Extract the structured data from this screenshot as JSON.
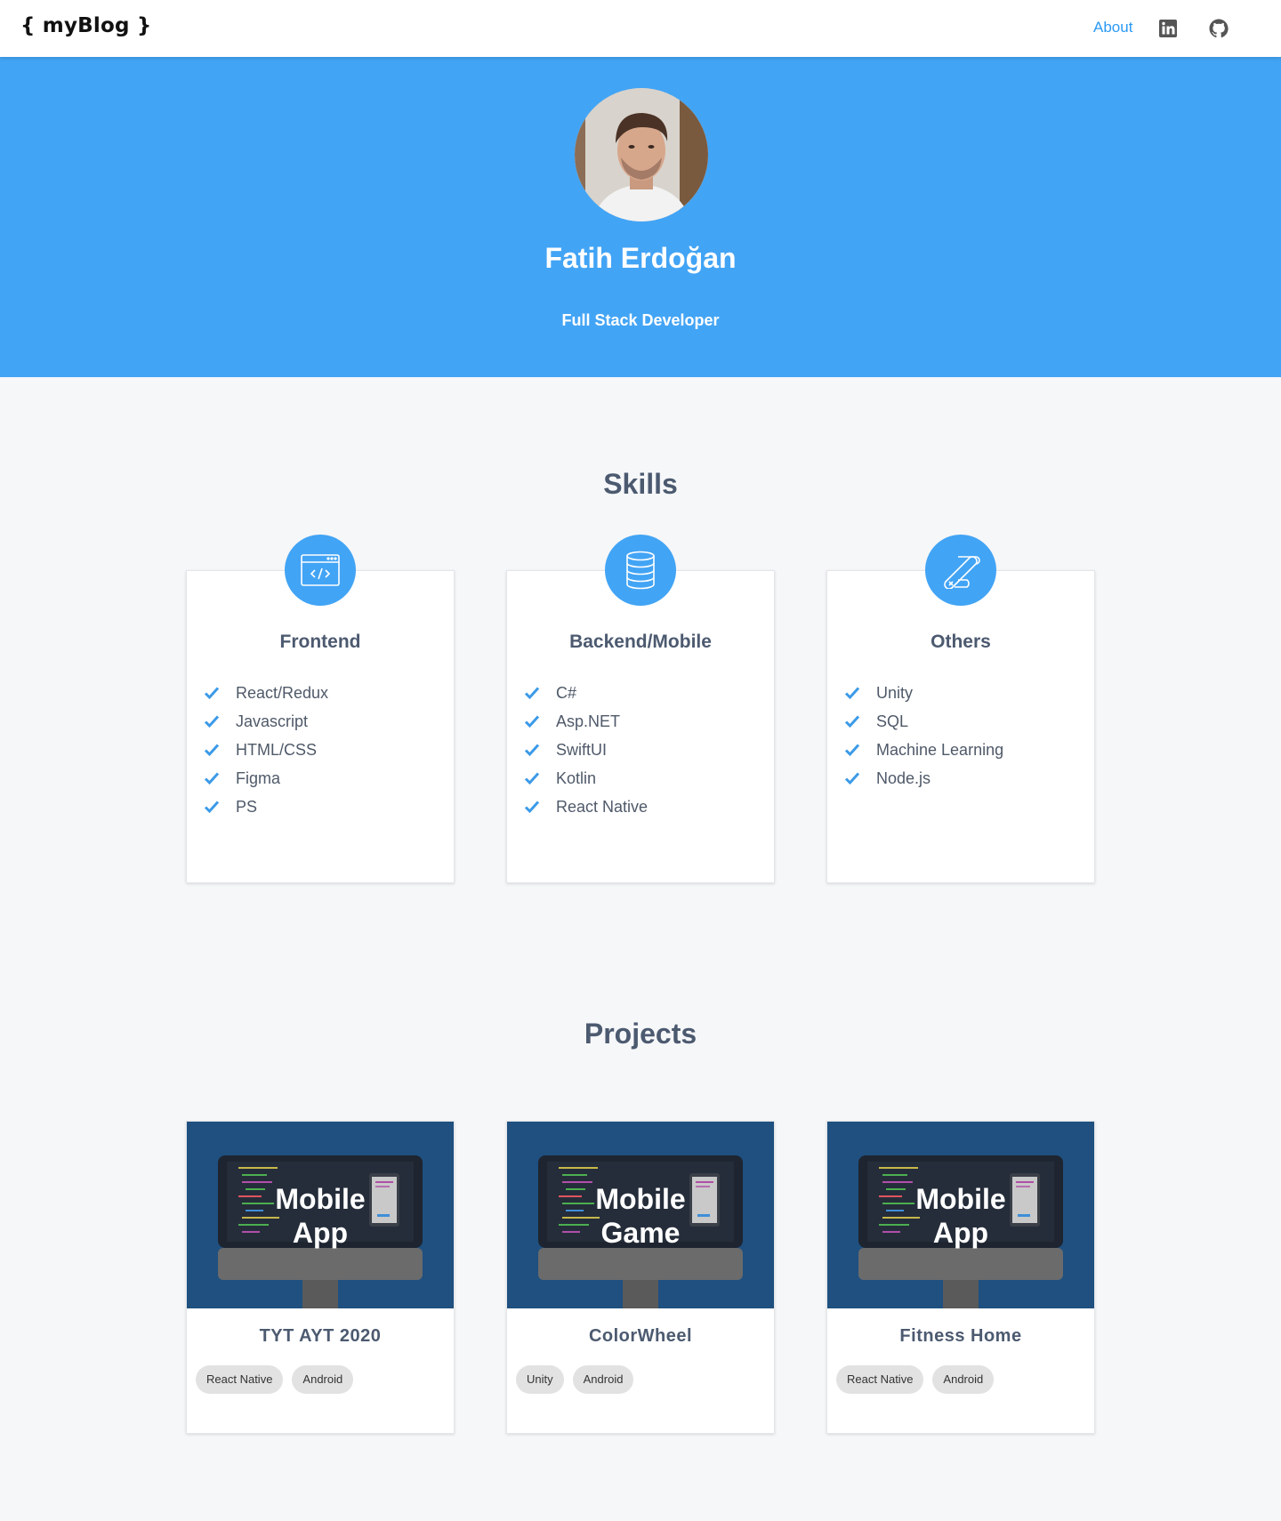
{
  "header": {
    "logo": "{ myBlog }",
    "nav_about": "About",
    "linkedin_icon": "linkedin-icon",
    "github_icon": "github-icon"
  },
  "hero": {
    "name": "Fatih Erdoğan",
    "role": "Full Stack Developer",
    "background": "#42a4f5"
  },
  "skills": {
    "title": "Skills",
    "cards": [
      {
        "icon": "code-window-icon",
        "heading": "Frontend",
        "items": [
          "React/Redux",
          "Javascript",
          "HTML/CSS",
          "Figma",
          "PS"
        ]
      },
      {
        "icon": "database-icon",
        "heading": "Backend/Mobile",
        "items": [
          "C#",
          "Asp.NET",
          "SwiftUI",
          "Kotlin",
          "React Native"
        ]
      },
      {
        "icon": "swiss-knife-icon",
        "heading": "Others",
        "items": [
          "Unity",
          "SQL",
          "Machine Learning",
          "Node.js"
        ]
      }
    ]
  },
  "projects": {
    "title": "Projects",
    "cards": [
      {
        "thumb_line1": "Mobile",
        "thumb_line2": "App",
        "name": "TYT AYT 2020",
        "tags": [
          "React Native",
          "Android"
        ]
      },
      {
        "thumb_line1": "Mobile",
        "thumb_line2": "Game",
        "name": "ColorWheel",
        "tags": [
          "Unity",
          "Android"
        ]
      },
      {
        "thumb_line1": "Mobile",
        "thumb_line2": "App",
        "name": "Fitness Home",
        "tags": [
          "React Native",
          "Android"
        ]
      }
    ]
  },
  "colors": {
    "accent": "#42a4f5",
    "link": "#2b9af3",
    "heading": "#4c5a70",
    "thumb_bg": "#1f5080"
  }
}
